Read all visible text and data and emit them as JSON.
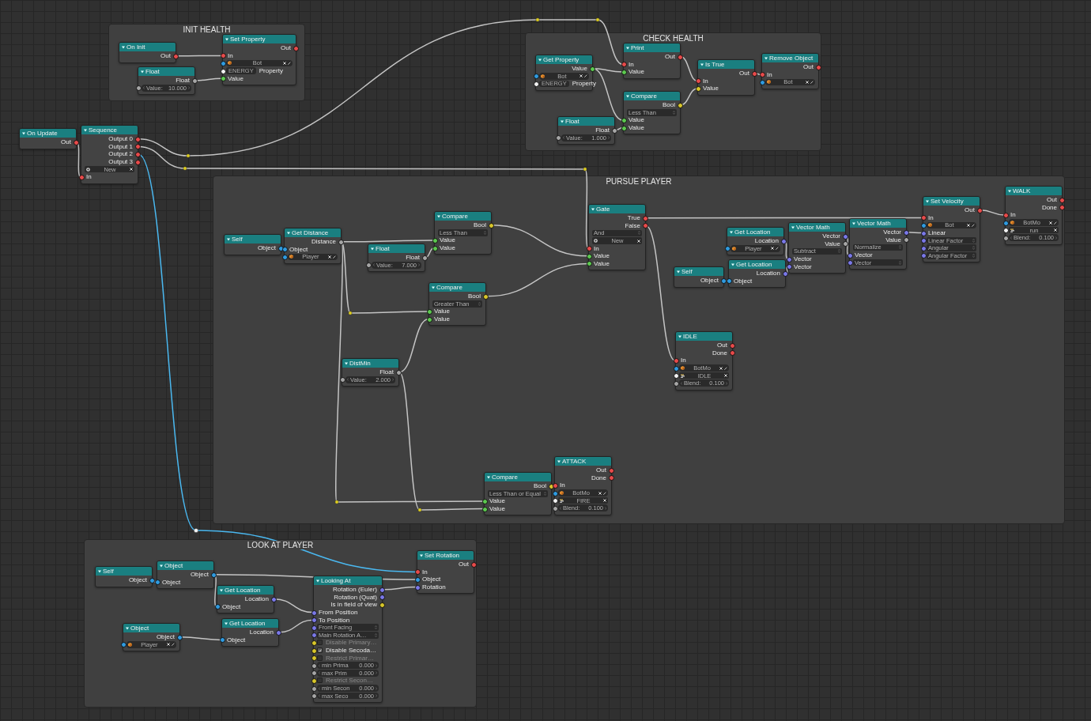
{
  "frames": [
    {
      "title": "INIT HEALTH"
    },
    {
      "title": "CHECK HEALTH"
    },
    {
      "title": "PURSUE PLAYER"
    },
    {
      "title": "LOOK AT PLAYER"
    }
  ],
  "nodes": [
    {
      "title": "On Init",
      "rows": [
        {
          "kind": "output",
          "label": "Out",
          "color": "#e84a4a"
        }
      ]
    },
    {
      "title": "Set Property",
      "rows": [
        {
          "kind": "output",
          "label": "Out",
          "color": "#e84a4a"
        },
        {
          "kind": "input",
          "label": "In",
          "color": "#e84a4a"
        },
        {
          "kind": "object",
          "value": "Bot",
          "color": "#2f9be0"
        },
        {
          "kind": "property",
          "value": "ENERGY",
          "label": "Property",
          "color": "#f2f2f2"
        },
        {
          "kind": "input",
          "label": "Value",
          "color": "#5cc94f"
        }
      ]
    },
    {
      "title": "Float",
      "rows": [
        {
          "kind": "output",
          "label": "Float",
          "color": "#a6a6a6"
        },
        {
          "kind": "number",
          "label": "Value:",
          "value": "10.000",
          "color": "#a6a6a6"
        }
      ]
    },
    {
      "title": "On Update",
      "rows": [
        {
          "kind": "output",
          "label": "Out",
          "color": "#e84a4a"
        }
      ]
    },
    {
      "title": "Sequence",
      "rows": [
        {
          "kind": "output",
          "label": "Output 0",
          "color": "#e84a4a"
        },
        {
          "kind": "output",
          "label": "Output 1",
          "color": "#e84a4a"
        },
        {
          "kind": "output",
          "label": "Output 2",
          "color": "#e84a4a"
        },
        {
          "kind": "output",
          "label": "Output 3",
          "color": "#e84a4a"
        },
        {
          "kind": "add",
          "value": "New"
        },
        {
          "kind": "input",
          "label": "In",
          "color": "#e84a4a"
        }
      ]
    },
    {
      "title": "Get Property",
      "rows": [
        {
          "kind": "output",
          "label": "Value",
          "color": "#5cc94f"
        },
        {
          "kind": "object",
          "value": "Bot",
          "color": "#2f9be0"
        },
        {
          "kind": "property",
          "value": "ENERGY",
          "label": "Property",
          "color": "#f2f2f2"
        }
      ]
    },
    {
      "title": "Print",
      "rows": [
        {
          "kind": "output",
          "label": "Out",
          "color": "#e84a4a"
        },
        {
          "kind": "input",
          "label": "In",
          "color": "#e84a4a"
        },
        {
          "kind": "input",
          "label": "Value",
          "color": "#5cc94f"
        }
      ]
    },
    {
      "title": "Is True",
      "rows": [
        {
          "kind": "output",
          "label": "Out",
          "color": "#e84a4a"
        },
        {
          "kind": "input",
          "label": "In",
          "color": "#e84a4a"
        },
        {
          "kind": "input",
          "label": "Value",
          "color": "#d8c62a"
        }
      ]
    },
    {
      "title": "Remove Object",
      "rows": [
        {
          "kind": "output",
          "label": "Out",
          "color": "#e84a4a"
        },
        {
          "kind": "input",
          "label": "In",
          "color": "#e84a4a"
        },
        {
          "kind": "object",
          "value": "Bot",
          "color": "#2f9be0"
        }
      ]
    },
    {
      "title": "Compare",
      "rows": [
        {
          "kind": "output",
          "label": "Bool",
          "color": "#d8c62a"
        },
        {
          "kind": "dropdown",
          "value": "Less Than"
        },
        {
          "kind": "input",
          "label": "Value",
          "color": "#5cc94f"
        },
        {
          "kind": "input",
          "label": "Value",
          "color": "#5cc94f"
        }
      ]
    },
    {
      "title": "Float",
      "rows": [
        {
          "kind": "output",
          "label": "Float",
          "color": "#a6a6a6"
        },
        {
          "kind": "number",
          "label": "Value:",
          "value": "1.000",
          "color": "#a6a6a6"
        }
      ]
    },
    {
      "title": "Self",
      "rows": [
        {
          "kind": "output",
          "label": "Object",
          "color": "#2f9be0"
        }
      ]
    },
    {
      "title": "Get Distance",
      "rows": [
        {
          "kind": "output",
          "label": "Distance",
          "color": "#a6a6a6"
        },
        {
          "kind": "input",
          "label": "Object",
          "color": "#2f9be0"
        },
        {
          "kind": "object",
          "value": "Player",
          "color": "#2f9be0"
        }
      ]
    },
    {
      "title": "Compare",
      "rows": [
        {
          "kind": "output",
          "label": "Bool",
          "color": "#d8c62a"
        },
        {
          "kind": "dropdown",
          "value": "Less Than"
        },
        {
          "kind": "input",
          "label": "Value",
          "color": "#5cc94f"
        },
        {
          "kind": "input",
          "label": "Value",
          "color": "#5cc94f"
        }
      ]
    },
    {
      "title": "Float",
      "rows": [
        {
          "kind": "output",
          "label": "Float",
          "color": "#a6a6a6"
        },
        {
          "kind": "number",
          "label": "Value:",
          "value": "7.000",
          "color": "#a6a6a6"
        }
      ]
    },
    {
      "title": "Compare",
      "rows": [
        {
          "kind": "output",
          "label": "Bool",
          "color": "#d8c62a"
        },
        {
          "kind": "dropdown",
          "value": "Greater Than"
        },
        {
          "kind": "input",
          "label": "Value",
          "color": "#5cc94f"
        },
        {
          "kind": "input",
          "label": "Value",
          "color": "#5cc94f"
        }
      ]
    },
    {
      "title": "DistMin",
      "rows": [
        {
          "kind": "output",
          "label": "Float",
          "color": "#a6a6a6"
        },
        {
          "kind": "number",
          "label": "Value:",
          "value": "2.000",
          "color": "#a6a6a6"
        }
      ]
    },
    {
      "title": "Gate",
      "rows": [
        {
          "kind": "output",
          "label": "True",
          "color": "#e84a4a"
        },
        {
          "kind": "output",
          "label": "False",
          "color": "#e84a4a"
        },
        {
          "kind": "dropdown",
          "value": "And"
        },
        {
          "kind": "add",
          "value": "New"
        },
        {
          "kind": "input",
          "label": "In",
          "color": "#e84a4a"
        },
        {
          "kind": "input",
          "label": "Value",
          "color": "#5cc94f"
        },
        {
          "kind": "input",
          "label": "Value",
          "color": "#5cc94f"
        }
      ]
    },
    {
      "title": "Get Location",
      "rows": [
        {
          "kind": "output",
          "label": "Location",
          "color": "#7a78e8"
        },
        {
          "kind": "object",
          "value": "Player",
          "color": "#2f9be0"
        }
      ]
    },
    {
      "title": "Self",
      "rows": [
        {
          "kind": "output",
          "label": "Object",
          "color": "#2f9be0"
        }
      ]
    },
    {
      "title": "Get Location",
      "rows": [
        {
          "kind": "output",
          "label": "Location",
          "color": "#7a78e8"
        },
        {
          "kind": "input",
          "label": "Object",
          "color": "#2f9be0"
        }
      ]
    },
    {
      "title": "Vector Math",
      "rows": [
        {
          "kind": "output",
          "label": "Vector",
          "color": "#7a78e8"
        },
        {
          "kind": "output",
          "label": "Value",
          "color": "#a6a6a6"
        },
        {
          "kind": "dropdown",
          "value": "Subtract"
        },
        {
          "kind": "input",
          "label": "Vector",
          "color": "#7a78e8"
        },
        {
          "kind": "input",
          "label": "Vector",
          "color": "#7a78e8"
        }
      ]
    },
    {
      "title": "Vector Math",
      "rows": [
        {
          "kind": "output",
          "label": "Vector",
          "color": "#7a78e8"
        },
        {
          "kind": "output",
          "label": "Value",
          "color": "#a6a6a6"
        },
        {
          "kind": "dropdown",
          "value": "Normalize"
        },
        {
          "kind": "input",
          "label": "Vector",
          "color": "#7a78e8"
        },
        {
          "kind": "dropdown",
          "value": "Vector",
          "color": "#7a78e8"
        }
      ]
    },
    {
      "title": "Set Velocity",
      "rows": [
        {
          "kind": "output",
          "label": "Out",
          "color": "#e84a4a"
        },
        {
          "kind": "input",
          "label": "In",
          "color": "#e84a4a"
        },
        {
          "kind": "object",
          "value": "Bot",
          "color": "#2f9be0"
        },
        {
          "kind": "input",
          "label": "Linear",
          "color": "#7a78e8"
        },
        {
          "kind": "dropdown",
          "value": "Linear Factor",
          "color": "#7a78e8"
        },
        {
          "kind": "dropdown",
          "value": "Angular",
          "color": "#7a78e8"
        },
        {
          "kind": "dropdown",
          "value": "Angular Factor",
          "color": "#7a78e8"
        }
      ]
    },
    {
      "title": "WALK",
      "rows": [
        {
          "kind": "output",
          "label": "Out",
          "color": "#e84a4a"
        },
        {
          "kind": "output",
          "label": "Done",
          "color": "#e84a4a"
        },
        {
          "kind": "input",
          "label": "In",
          "color": "#e84a4a"
        },
        {
          "kind": "object",
          "value": "BotMo",
          "color": "#2f9be0"
        },
        {
          "kind": "action",
          "value": "run",
          "color": "#f2f2f2"
        },
        {
          "kind": "number",
          "label": "Blend:",
          "value": "0.100",
          "color": "#a6a6a6"
        }
      ]
    },
    {
      "title": "IDLE",
      "rows": [
        {
          "kind": "output",
          "label": "Out",
          "color": "#e84a4a"
        },
        {
          "kind": "output",
          "label": "Done",
          "color": "#e84a4a"
        },
        {
          "kind": "input",
          "label": "In",
          "color": "#e84a4a"
        },
        {
          "kind": "object",
          "value": "BotMo",
          "color": "#2f9be0"
        },
        {
          "kind": "action",
          "value": "IDLE",
          "color": "#f2f2f2"
        },
        {
          "kind": "number",
          "label": "Blend:",
          "value": "0.100",
          "color": "#a6a6a6"
        }
      ]
    },
    {
      "title": "Compare",
      "rows": [
        {
          "kind": "output",
          "label": "Bool",
          "color": "#d8c62a"
        },
        {
          "kind": "dropdown",
          "value": "Less Than or Equal"
        },
        {
          "kind": "input",
          "label": "Value",
          "color": "#5cc94f"
        },
        {
          "kind": "input",
          "label": "Value",
          "color": "#5cc94f"
        }
      ]
    },
    {
      "title": "ATTACK",
      "rows": [
        {
          "kind": "output",
          "label": "Out",
          "color": "#e84a4a"
        },
        {
          "kind": "output",
          "label": "Done",
          "color": "#e84a4a"
        },
        {
          "kind": "input",
          "label": "In",
          "color": "#e84a4a"
        },
        {
          "kind": "object",
          "value": "BotMo",
          "color": "#2f9be0"
        },
        {
          "kind": "action",
          "value": "FIRE",
          "color": "#f2f2f2"
        },
        {
          "kind": "number",
          "label": "Blend:",
          "value": "0.100",
          "color": "#a6a6a6"
        }
      ]
    },
    {
      "title": "Self",
      "rows": [
        {
          "kind": "output",
          "label": "Object",
          "color": "#2f9be0"
        }
      ]
    },
    {
      "title": "Object",
      "rows": [
        {
          "kind": "output",
          "label": "Object",
          "color": "#2f9be0"
        },
        {
          "kind": "input",
          "label": "Object",
          "color": "#2f9be0"
        }
      ]
    },
    {
      "title": "Get Location",
      "rows": [
        {
          "kind": "output",
          "label": "Location",
          "color": "#7a78e8"
        },
        {
          "kind": "input",
          "label": "Object",
          "color": "#2f9be0"
        }
      ]
    },
    {
      "title": "Object",
      "rows": [
        {
          "kind": "output",
          "label": "Object",
          "color": "#2f9be0"
        },
        {
          "kind": "object",
          "value": "Player",
          "color": "#2f9be0"
        }
      ]
    },
    {
      "title": "Get Location",
      "rows": [
        {
          "kind": "output",
          "label": "Location",
          "color": "#7a78e8"
        },
        {
          "kind": "input",
          "label": "Object",
          "color": "#2f9be0"
        }
      ]
    },
    {
      "title": "Looking At",
      "rows": [
        {
          "kind": "output",
          "label": "Rotation (Euler)",
          "color": "#7a78e8"
        },
        {
          "kind": "output",
          "label": "Rotation (Quat)",
          "color": "#7a78e8"
        },
        {
          "kind": "output",
          "label": "Is in field of view",
          "color": "#d8c62a"
        },
        {
          "kind": "input",
          "label": "From Position",
          "color": "#7a78e8"
        },
        {
          "kind": "input",
          "label": "To Position",
          "color": "#7a78e8"
        },
        {
          "kind": "dropdown",
          "value": "Front Facing",
          "color": "#7a78e8"
        },
        {
          "kind": "dropdown",
          "value": "Main Rotation A…",
          "color": "#7a78e8"
        },
        {
          "kind": "checkbox",
          "label": "Disable Primary…",
          "checked": false,
          "disabled": true,
          "color": "#d8c62a"
        },
        {
          "kind": "checkbox",
          "label": "Disable Secoda…",
          "checked": true,
          "disabled": false,
          "color": "#d8c62a"
        },
        {
          "kind": "checkbox",
          "label": "Restrict Primar…",
          "checked": false,
          "disabled": true,
          "color": "#d8c62a"
        },
        {
          "kind": "number",
          "label": "min Prima",
          "value": "0.000",
          "color": "#a6a6a6"
        },
        {
          "kind": "number",
          "label": "max Prim",
          "value": "0.000",
          "color": "#a6a6a6"
        },
        {
          "kind": "checkbox",
          "label": "Restrict Secon…",
          "checked": false,
          "disabled": true,
          "color": "#d8c62a"
        },
        {
          "kind": "number",
          "label": "min Secon",
          "value": "0.000",
          "color": "#a6a6a6"
        },
        {
          "kind": "number",
          "label": "max Seco",
          "value": "0.000",
          "color": "#a6a6a6"
        }
      ]
    },
    {
      "title": "Set Rotation",
      "rows": [
        {
          "kind": "output",
          "label": "Out",
          "color": "#e84a4a"
        },
        {
          "kind": "input",
          "label": "In",
          "color": "#e84a4a"
        },
        {
          "kind": "input",
          "label": "Object",
          "color": "#2f9be0"
        },
        {
          "kind": "input",
          "label": "Rotation",
          "color": "#7a78e8"
        }
      ]
    }
  ]
}
